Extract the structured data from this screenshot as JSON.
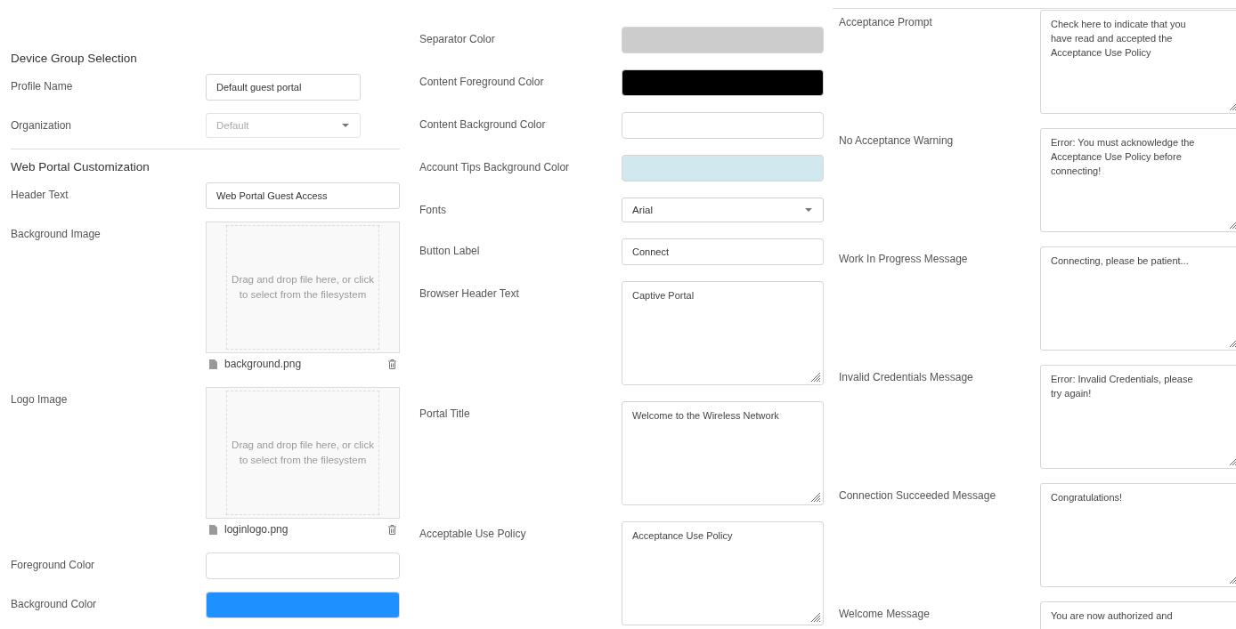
{
  "columns": [
    {
      "sections": [
        {
          "heading": "Device Group Selection",
          "rows": [
            {
              "kind": "text",
              "label": "Profile Name",
              "value": "Default guest portal"
            },
            {
              "kind": "select",
              "label": "Organization",
              "value": "Default",
              "disabled": true
            }
          ]
        },
        {
          "heading": "Web Portal Customization",
          "rows": [
            {
              "kind": "text",
              "label": "Header Text",
              "value": "Web Portal Guest Access"
            },
            {
              "kind": "upload",
              "label": "Background Image",
              "hint": "Drag and drop file here, or click to select from the filesystem",
              "file": "background.png"
            },
            {
              "kind": "upload",
              "label": "Logo Image",
              "hint": "Drag and drop file here, or click to select from the filesystem",
              "file": "loginlogo.png"
            },
            {
              "kind": "color",
              "label": "Foreground Color",
              "color": "#ffffff"
            },
            {
              "kind": "color",
              "label": "Background Color",
              "color": "#1e90ff"
            }
          ]
        }
      ]
    },
    {
      "sections": [
        {
          "rows": [
            {
              "kind": "color",
              "label": "Separator Color",
              "color": "#cccccc"
            },
            {
              "kind": "color",
              "label": "Content Foreground Color",
              "color": "#000000"
            },
            {
              "kind": "color",
              "label": "Content Background Color",
              "color": "#ffffff"
            },
            {
              "kind": "color",
              "label": "Account Tips Background Color",
              "color": "#d1e8ee"
            },
            {
              "kind": "select",
              "label": "Fonts",
              "value": "Arial",
              "disabled": false
            },
            {
              "kind": "text",
              "label": "Button Label",
              "value": "Connect"
            },
            {
              "kind": "textarea",
              "label": "Browser Header Text",
              "value": "Captive Portal"
            },
            {
              "kind": "textarea",
              "label": "Portal Title",
              "value": "Welcome to the Wireless Network"
            },
            {
              "kind": "textarea",
              "label": "Acceptable Use Policy",
              "value": "Acceptance Use Policy"
            }
          ]
        }
      ]
    },
    {
      "sections": [
        {
          "rows": [
            {
              "kind": "textarea",
              "label": "Acceptance Prompt",
              "value": "Check here to indicate that you have read and accepted the Acceptance Use Policy"
            },
            {
              "kind": "textarea",
              "label": "No Acceptance Warning",
              "value": "Error: You must acknowledge the Acceptance Use Policy before connecting!"
            },
            {
              "kind": "textarea",
              "label": "Work In Progress Message",
              "value": "Connecting, please be patient..."
            },
            {
              "kind": "textarea",
              "label": "Invalid Credentials Message",
              "value": "Error: Invalid Credentials, please try again!"
            },
            {
              "kind": "textarea",
              "label": "Connection Succeeded Message",
              "value": "Congratulations!"
            },
            {
              "kind": "textarea",
              "label": "Welcome Message",
              "value": "You are now authorized and"
            }
          ]
        }
      ]
    }
  ]
}
